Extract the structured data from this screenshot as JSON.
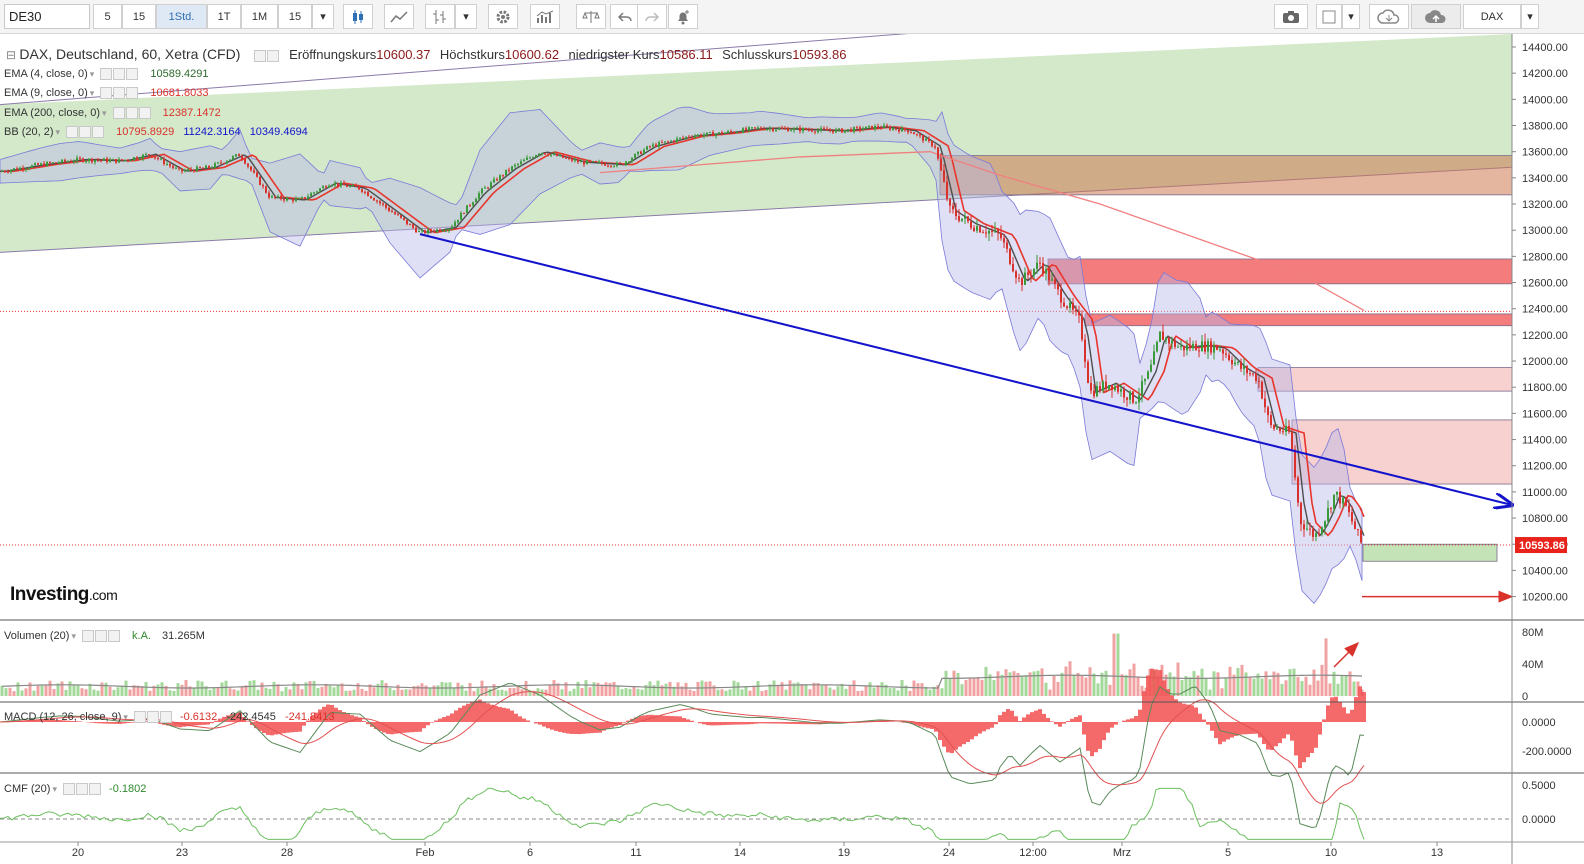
{
  "toolbar": {
    "symbol": "DE30",
    "intervals": [
      "5",
      "15",
      "1Std.",
      "1T",
      "1M",
      "15"
    ],
    "active_interval": "1Std.",
    "right_symbol": "DAX",
    "icons": [
      "candles-icon",
      "line-chart-icon",
      "ohlc-bars-icon",
      "settings-gear-icon",
      "indicators-icon",
      "compare-scale-icon",
      "undo-icon",
      "redo-icon",
      "alert-bell-icon",
      "camera-icon",
      "box-icon",
      "cloud-download-icon",
      "cloud-upload-icon"
    ]
  },
  "legend": {
    "main": {
      "title": "DAX, Deutschland, 60, Xetra (CFD)",
      "open_label": "Eröffnungskurs",
      "open": "10600.37",
      "high_label": "Höchstkurs",
      "high": "10600.62",
      "low_label": "niedrigster Kurs",
      "low": "10586.11",
      "close_label": "Schlusskurs",
      "close": "10593.86"
    },
    "ema4": {
      "label": "EMA (4, close, 0)",
      "value": "10589.4291"
    },
    "ema9": {
      "label": "EMA (9, close, 0)",
      "value": "10681.8033"
    },
    "ema200": {
      "label": "EMA (200, close, 0)",
      "value": "12387.1472"
    },
    "bb": {
      "label": "BB (20, 2)",
      "v1": "10795.8929",
      "v2": "11242.3164",
      "v3": "10349.4694"
    }
  },
  "volume_legend": {
    "label": "Volumen (20)",
    "ka": "k.A.",
    "value": "31.265M"
  },
  "macd_legend": {
    "label": "MACD (12, 26, close, 9)",
    "v1": "-0.6132",
    "v2": "-242.4545",
    "v3": "-241.8413"
  },
  "cmf_legend": {
    "label": "CMF (20)",
    "value": "-0.1802"
  },
  "logo": {
    "main": "Investing",
    "suffix": ".com"
  },
  "colors": {
    "up": "#3a9a3a",
    "down": "#d9312b",
    "ema4": "#4d4d4d",
    "ema9": "#e8352c",
    "ema200": "#f08080",
    "bb_fill": "#b7b7e8",
    "bb_line": "#7a7ad8",
    "channel_fill": "#c8e3bd",
    "trend_line": "#1414cc",
    "vol_up": "#a3d89a",
    "vol_down": "#f0a2a2",
    "cmf": "#6cbf5f",
    "macd_hist": "#f25050"
  },
  "chart_data": [
    {
      "type": "candlestick",
      "title": "DAX, Deutschland, 60, Xetra (CFD)",
      "x_tick_labels": [
        "20",
        "23",
        "28",
        "Feb",
        "6",
        "11",
        "14",
        "19",
        "24",
        "12:00",
        "Mrz",
        "5",
        "10",
        "13"
      ],
      "y_tick_labels": [
        "14400.00",
        "14200.00",
        "14000.00",
        "13800.00",
        "13600.00",
        "13400.00",
        "13200.00",
        "13000.00",
        "12800.00",
        "12600.00",
        "12400.00",
        "12200.00",
        "12000.00",
        "11800.00",
        "11600.00",
        "11400.00",
        "11200.00",
        "11000.00",
        "10800.00",
        "10600.00",
        "10400.00",
        "10200.00"
      ],
      "ylim": [
        10100,
        14450
      ],
      "last_price_label": "10593.86",
      "price_path_approx": [
        [
          0,
          13450
        ],
        [
          40,
          13500
        ],
        [
          80,
          13540
        ],
        [
          120,
          13530
        ],
        [
          150,
          13580
        ],
        [
          180,
          13450
        ],
        [
          210,
          13480
        ],
        [
          240,
          13580
        ],
        [
          270,
          13250
        ],
        [
          300,
          13230
        ],
        [
          330,
          13360
        ],
        [
          360,
          13320
        ],
        [
          390,
          13150
        ],
        [
          420,
          12980
        ],
        [
          450,
          13020
        ],
        [
          480,
          13290
        ],
        [
          510,
          13470
        ],
        [
          540,
          13600
        ],
        [
          580,
          13520
        ],
        [
          620,
          13500
        ],
        [
          650,
          13640
        ],
        [
          690,
          13720
        ],
        [
          720,
          13740
        ],
        [
          760,
          13780
        ],
        [
          800,
          13770
        ],
        [
          840,
          13760
        ],
        [
          880,
          13790
        ],
        [
          910,
          13760
        ],
        [
          935,
          13640
        ],
        [
          950,
          13150
        ],
        [
          970,
          13050
        ],
        [
          1000,
          12960
        ],
        [
          1020,
          12600
        ],
        [
          1040,
          12750
        ],
        [
          1060,
          12500
        ],
        [
          1080,
          12300
        ],
        [
          1090,
          11760
        ],
        [
          1110,
          11830
        ],
        [
          1135,
          11700
        ],
        [
          1150,
          11920
        ],
        [
          1160,
          12200
        ],
        [
          1180,
          12100
        ],
        [
          1200,
          12120
        ],
        [
          1220,
          12100
        ],
        [
          1240,
          11950
        ],
        [
          1258,
          11870
        ],
        [
          1270,
          11500
        ],
        [
          1290,
          11450
        ],
        [
          1300,
          10780
        ],
        [
          1315,
          10660
        ],
        [
          1325,
          10800
        ],
        [
          1335,
          10990
        ],
        [
          1345,
          10900
        ],
        [
          1355,
          10720
        ],
        [
          1362,
          10594
        ]
      ],
      "ema200_path_approx": [
        [
          600,
          13440
        ],
        [
          700,
          13500
        ],
        [
          800,
          13560
        ],
        [
          930,
          13600
        ],
        [
          1000,
          13420
        ],
        [
          1100,
          13200
        ],
        [
          1200,
          12930
        ],
        [
          1300,
          12660
        ],
        [
          1364,
          12387
        ]
      ],
      "annotations": [
        {
          "kind": "channel",
          "from": [
            0,
            13960
          ],
          "to": [
            1260,
            14730
          ],
          "lower_from": [
            0,
            12830
          ],
          "lower_to": [
            1510,
            13480
          ]
        },
        {
          "kind": "trendline",
          "from": [
            420,
            12970
          ],
          "to": [
            1512,
            10900
          ]
        },
        {
          "kind": "zone",
          "y": [
            13270,
            13570
          ],
          "x": [
            940,
            1512
          ],
          "color": "brown"
        },
        {
          "kind": "zone",
          "y": [
            12590,
            12780
          ],
          "x": [
            1048,
            1512
          ],
          "color": "red"
        },
        {
          "kind": "zone",
          "y": [
            12270,
            12360
          ],
          "x": [
            1085,
            1512
          ],
          "color": "red"
        },
        {
          "kind": "zone",
          "y": [
            11770,
            11950
          ],
          "x": [
            1258,
            1512
          ],
          "color": "pink"
        },
        {
          "kind": "zone",
          "y": [
            11060,
            11550
          ],
          "x": [
            1292,
            1512
          ],
          "color": "pink"
        },
        {
          "kind": "zone",
          "y": [
            10470,
            10600
          ],
          "x": [
            1363,
            1497
          ],
          "color": "green"
        },
        {
          "kind": "hline_dotted",
          "y": 12380
        },
        {
          "kind": "hline_dotted",
          "y": 10594
        },
        {
          "kind": "arrow",
          "y": 10200,
          "x": [
            1362,
            1512
          ]
        }
      ]
    },
    {
      "type": "bar",
      "title": "Volumen (20)",
      "y_tick_labels": [
        "80M",
        "40M",
        "0"
      ],
      "ylim": [
        0,
        85
      ]
    },
    {
      "type": "line",
      "title": "MACD (12, 26, close, 9)",
      "y_tick_labels": [
        "0.0000",
        "-200.0000"
      ]
    },
    {
      "type": "line",
      "title": "CMF (20)",
      "y_tick_labels": [
        "0.5000",
        "0.0000"
      ]
    }
  ]
}
